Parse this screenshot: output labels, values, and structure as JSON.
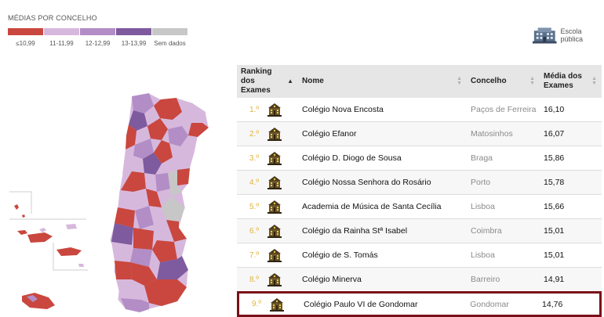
{
  "legend": {
    "title": "MÉDIAS POR CONCELHO",
    "items": [
      {
        "label": "≤10,99",
        "color": "#c9473e"
      },
      {
        "label": "11-11,99",
        "color": "#d7b8dd"
      },
      {
        "label": "12-12,99",
        "color": "#b38dc6"
      },
      {
        "label": "13-13,99",
        "color": "#7e5a9e"
      },
      {
        "label": "Sem dados",
        "color": "#c7c7c7"
      }
    ]
  },
  "school_key": {
    "label": "Escola pública",
    "icon": "public-school-icon"
  },
  "table": {
    "headers": {
      "rank": "Ranking dos Exames",
      "name": "Nome",
      "concelho": "Concelho",
      "media": "Média dos Exames"
    },
    "rows": [
      {
        "rank": "1.º",
        "name": "Colégio Nova Encosta",
        "concelho": "Paços de Ferreira",
        "media": "16,10"
      },
      {
        "rank": "2.º",
        "name": "Colégio Efanor",
        "concelho": "Matosinhos",
        "media": "16,07"
      },
      {
        "rank": "3.º",
        "name": "Colégio D. Diogo de Sousa",
        "concelho": "Braga",
        "media": "15,86"
      },
      {
        "rank": "4.º",
        "name": "Colégio Nossa Senhora do Rosário",
        "concelho": "Porto",
        "media": "15,78"
      },
      {
        "rank": "5.º",
        "name": "Academia de Música de Santa Cecília",
        "concelho": "Lisboa",
        "media": "15,66"
      },
      {
        "rank": "6.º",
        "name": "Colégio da Rainha Stª Isabel",
        "concelho": "Coimbra",
        "media": "15,01"
      },
      {
        "rank": "7.º",
        "name": "Colégio de S. Tomás",
        "concelho": "Lisboa",
        "media": "15,01"
      },
      {
        "rank": "8.º",
        "name": "Colégio Minerva",
        "concelho": "Barreiro",
        "media": "14,91"
      },
      {
        "rank": "9.º",
        "name": "Colégio Paulo VI de Gondomar",
        "concelho": "Gondomar",
        "media": "14,76"
      }
    ],
    "row_icon": "private-school-icon",
    "highlight_color": "#7a1018",
    "rank_color": "#e0b43a"
  }
}
